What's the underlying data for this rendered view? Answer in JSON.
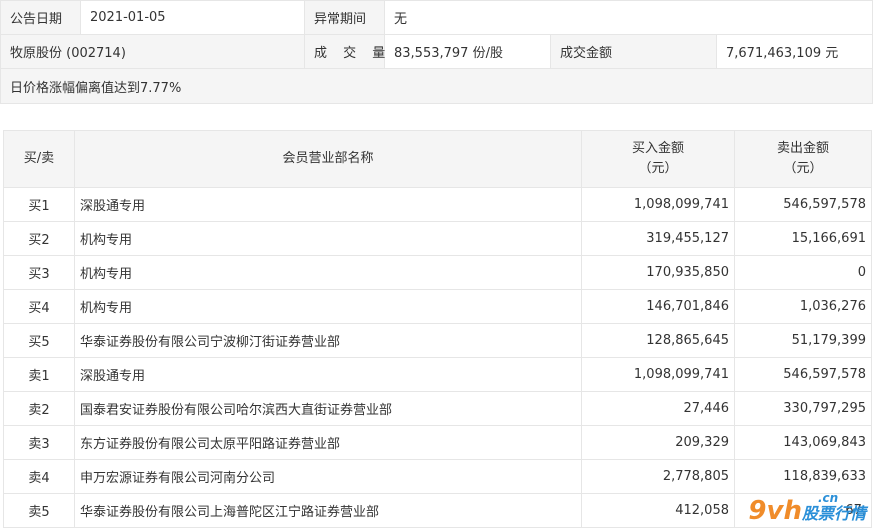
{
  "info": {
    "announce_label": "公告日期",
    "announce_date": "2021-01-05",
    "abnormal_label": "异常期间",
    "abnormal_value": "无",
    "stock": "牧原股份 (002714)",
    "volume_label": "成 交 量",
    "volume_value": "83,553,797 份/股",
    "amount_label": "成交金额",
    "amount_value": "7,671,463,109 元",
    "reason": "日价格涨幅偏离值达到7.77%"
  },
  "table": {
    "headers": {
      "side": "买/卖",
      "name": "会员营业部名称",
      "buy_line1": "买入金额",
      "buy_line2": "（元）",
      "sell_line1": "卖出金额",
      "sell_line2": "（元）"
    },
    "rows": [
      {
        "side": "买1",
        "name": "深股通专用",
        "buy": "1,098,099,741",
        "sell": "546,597,578"
      },
      {
        "side": "买2",
        "name": "机构专用",
        "buy": "319,455,127",
        "sell": "15,166,691"
      },
      {
        "side": "买3",
        "name": "机构专用",
        "buy": "170,935,850",
        "sell": "0"
      },
      {
        "side": "买4",
        "name": "机构专用",
        "buy": "146,701,846",
        "sell": "1,036,276"
      },
      {
        "side": "买5",
        "name": "华泰证券股份有限公司宁波柳汀街证券营业部",
        "buy": "128,865,645",
        "sell": "51,179,399"
      },
      {
        "side": "卖1",
        "name": "深股通专用",
        "buy": "1,098,099,741",
        "sell": "546,597,578"
      },
      {
        "side": "卖2",
        "name": "国泰君安证券股份有限公司哈尔滨西大直街证券营业部",
        "buy": "27,446",
        "sell": "330,797,295"
      },
      {
        "side": "卖3",
        "name": "东方证券股份有限公司太原平阳路证券营业部",
        "buy": "209,329",
        "sell": "143,069,843"
      },
      {
        "side": "卖4",
        "name": "申万宏源证券有限公司河南分公司",
        "buy": "2,778,805",
        "sell": "118,839,633"
      },
      {
        "side": "卖5",
        "name": "华泰证券股份有限公司上海普陀区江宁路证券营业部",
        "buy": "412,058",
        "sell": "67,"
      }
    ]
  },
  "watermark": {
    "logo": "9vh",
    "domain": ".cn",
    "text": "股票行情"
  }
}
